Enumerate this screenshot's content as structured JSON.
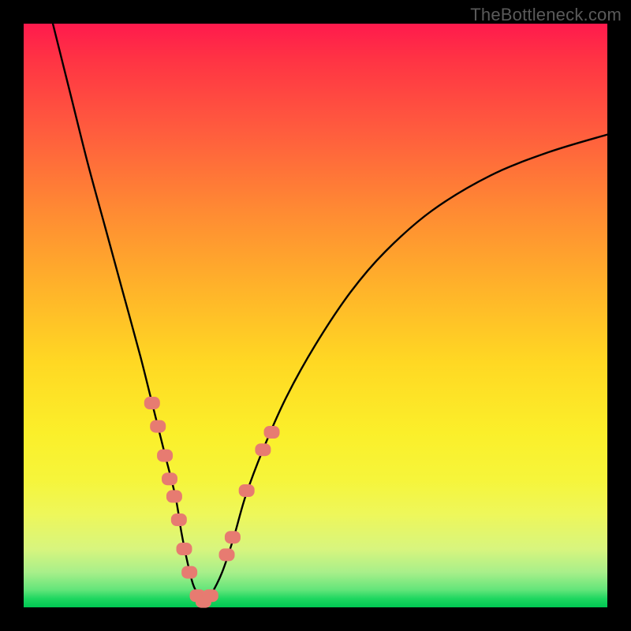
{
  "watermark": "TheBottleneck.com",
  "chart_data": {
    "type": "line",
    "title": "",
    "xlabel": "",
    "ylabel": "",
    "xlim": [
      0,
      100
    ],
    "ylim": [
      0,
      100
    ],
    "grid": false,
    "legend": false,
    "series": [
      {
        "name": "bottleneck-curve",
        "x": [
          5,
          8,
          11,
          14,
          17,
          20,
          22,
          24,
          26,
          27,
          28,
          29,
          30,
          31,
          32,
          34,
          36,
          38,
          41,
          45,
          50,
          56,
          62,
          70,
          80,
          90,
          100
        ],
        "y": [
          100,
          88,
          76,
          65,
          54,
          43,
          35,
          27,
          19,
          13,
          8,
          4,
          2,
          1,
          2,
          6,
          12,
          19,
          27,
          36,
          45,
          54,
          61,
          68,
          74,
          78,
          81
        ]
      }
    ],
    "markers": {
      "name": "highlighted-points",
      "points": [
        {
          "x": 22.0,
          "y": 35
        },
        {
          "x": 23.0,
          "y": 31
        },
        {
          "x": 24.2,
          "y": 26
        },
        {
          "x": 25.0,
          "y": 22
        },
        {
          "x": 25.8,
          "y": 19
        },
        {
          "x": 26.6,
          "y": 15
        },
        {
          "x": 27.5,
          "y": 10
        },
        {
          "x": 28.4,
          "y": 6
        },
        {
          "x": 29.8,
          "y": 2
        },
        {
          "x": 30.8,
          "y": 1
        },
        {
          "x": 32.0,
          "y": 2
        },
        {
          "x": 34.8,
          "y": 9
        },
        {
          "x": 35.8,
          "y": 12
        },
        {
          "x": 38.2,
          "y": 20
        },
        {
          "x": 41.0,
          "y": 27
        },
        {
          "x": 42.5,
          "y": 30
        }
      ]
    },
    "background_gradient": {
      "top": "#ff1a4d",
      "bottom": "#00c853"
    }
  }
}
